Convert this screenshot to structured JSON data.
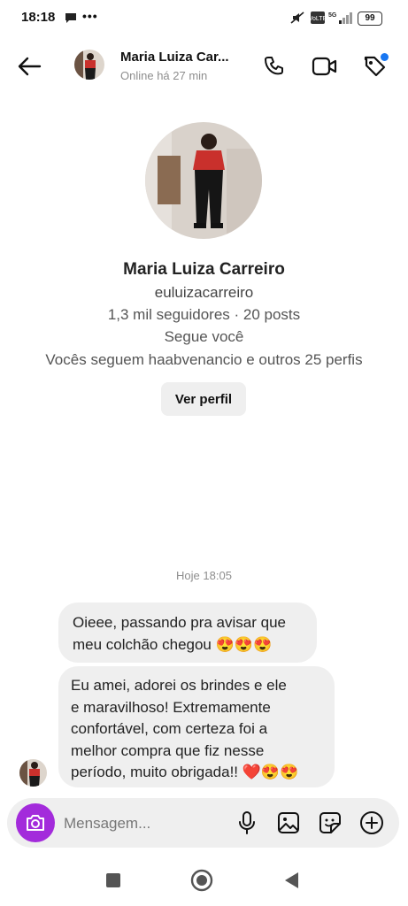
{
  "status_bar": {
    "time": "18:18",
    "more": "•••",
    "battery": "99",
    "network": "5G"
  },
  "header": {
    "name": "Maria Luiza Car...",
    "status": "Online há 27 min"
  },
  "profile": {
    "name": "Maria Luiza Carreiro",
    "username": "euluizacarreiro",
    "stats": "1,3 mil seguidores · 20 posts",
    "follows_you": "Segue você",
    "mutual": "Vocês seguem haabvenancio e outros 25 perfis",
    "view_profile_label": "Ver perfil"
  },
  "conversation": {
    "timestamp": "Hoje 18:05",
    "messages": [
      {
        "lines": [
          "Oieee, passando pra avisar que",
          "meu colchão chegou 😍😍😍"
        ]
      },
      {
        "lines": [
          "Eu amei, adorei os brindes e ele",
          "e maravilhoso! Extremamente",
          "confortável, com certeza foi a",
          "melhor compra que fiz nesse",
          "período, muito obrigada!! ❤️😍😍"
        ]
      }
    ]
  },
  "composer": {
    "placeholder": "Mensagem..."
  },
  "colors": {
    "accent": "#a32bdb",
    "bubble": "#efefef",
    "notification_dot": "#1877f2",
    "muted_text": "#8e8e8e"
  },
  "icons": [
    "back-arrow-icon",
    "phone-icon",
    "video-camera-icon",
    "tag-icon",
    "camera-icon",
    "microphone-icon",
    "gallery-icon",
    "sticker-icon",
    "plus-icon",
    "nav-recents-icon",
    "nav-home-icon",
    "nav-back-icon"
  ]
}
